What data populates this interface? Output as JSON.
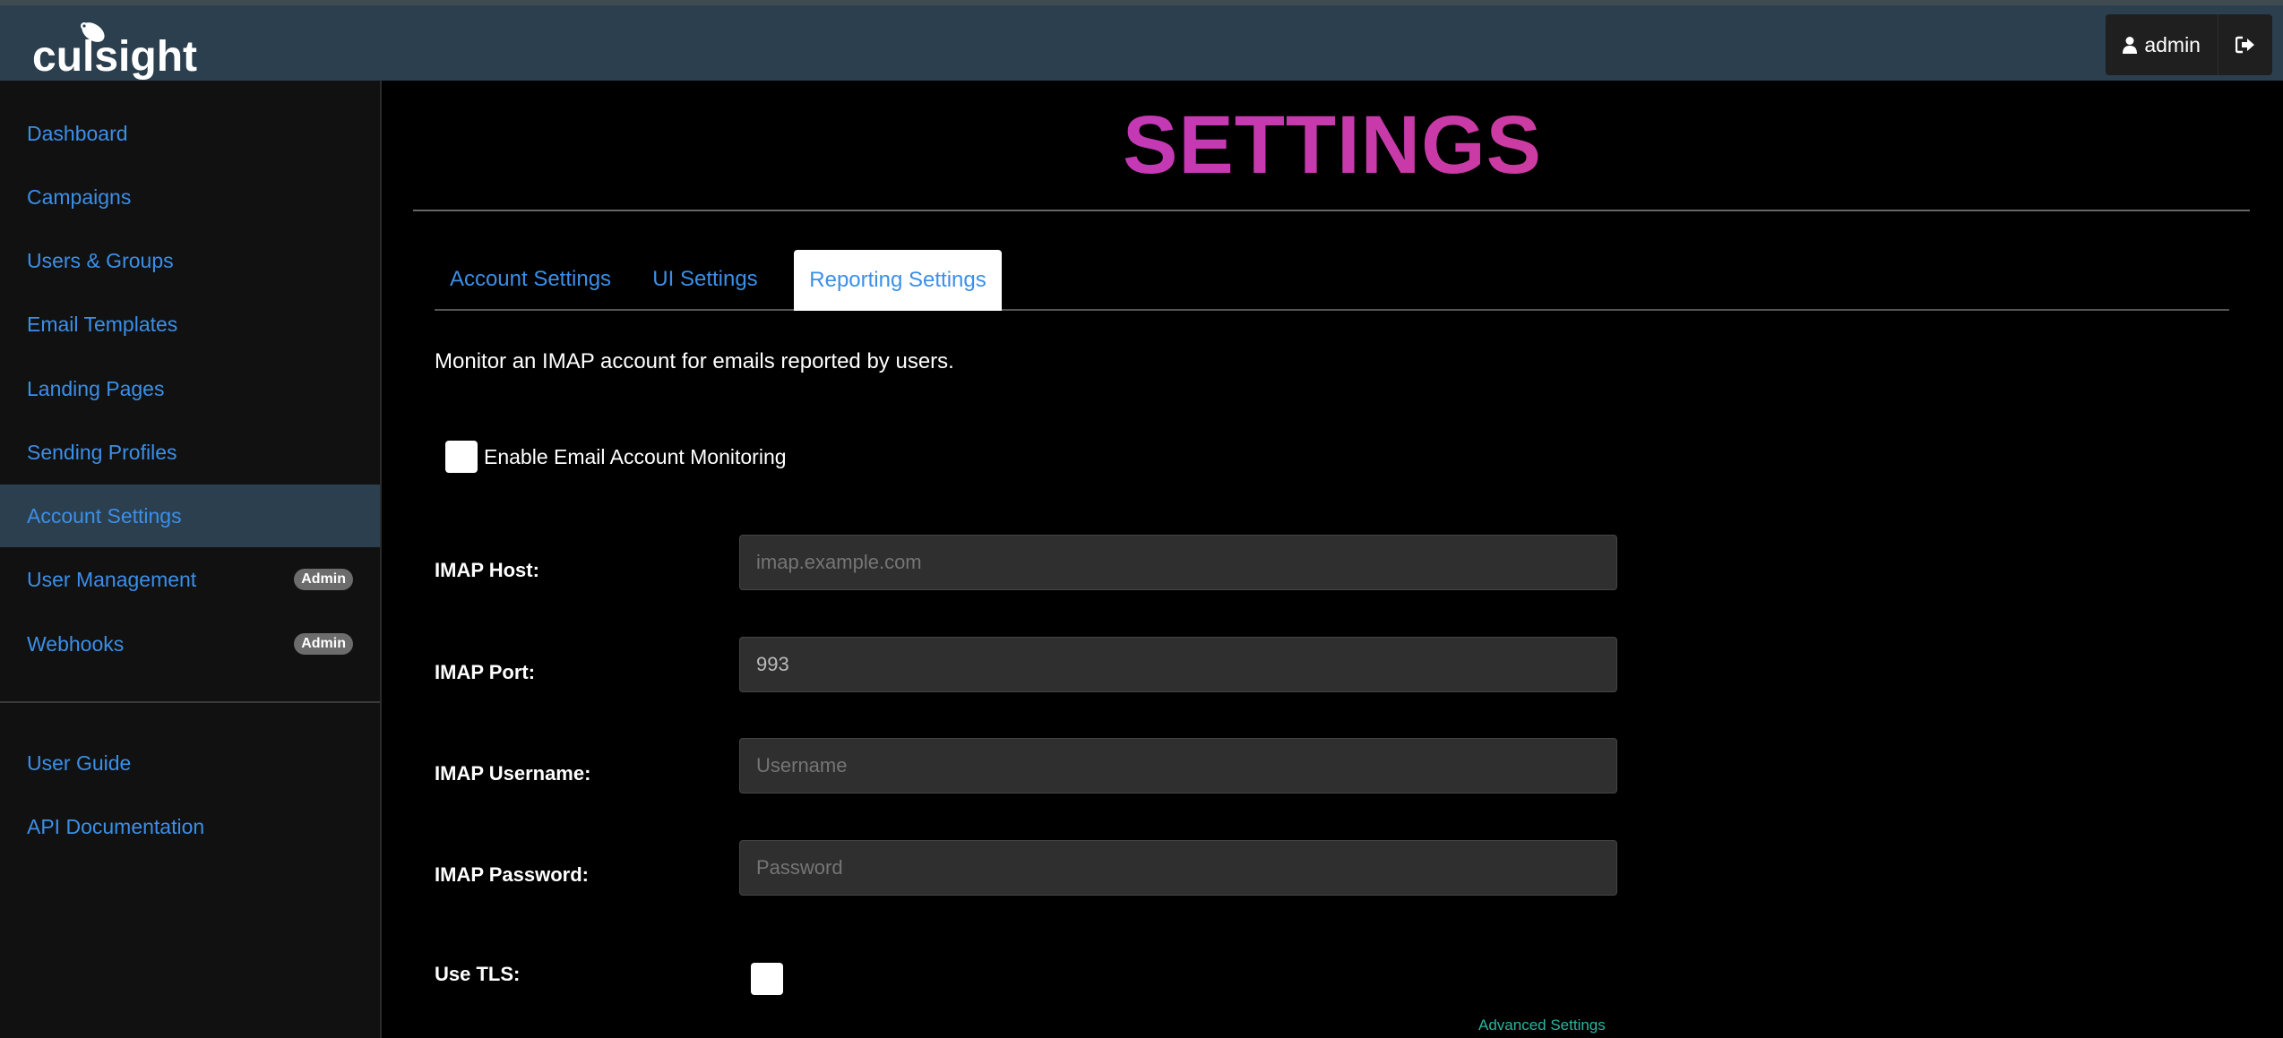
{
  "header": {
    "logo_text": "culsight",
    "user_label": "admin"
  },
  "sidebar": {
    "items": [
      {
        "label": "Dashboard"
      },
      {
        "label": "Campaigns"
      },
      {
        "label": "Users & Groups"
      },
      {
        "label": "Email Templates"
      },
      {
        "label": "Landing Pages"
      },
      {
        "label": "Sending Profiles"
      },
      {
        "label": "Account Settings"
      },
      {
        "label": "User Management",
        "badge": "Admin"
      },
      {
        "label": "Webhooks",
        "badge": "Admin"
      }
    ],
    "footer_items": [
      {
        "label": "User Guide"
      },
      {
        "label": "API Documentation"
      }
    ]
  },
  "main": {
    "title": "SETTINGS",
    "tabs": [
      {
        "label": "Account Settings"
      },
      {
        "label": "UI Settings"
      },
      {
        "label": "Reporting Settings"
      }
    ],
    "description": "Monitor an IMAP account for emails reported by users.",
    "enable_label": "Enable Email Account Monitoring",
    "fields": [
      {
        "label": "IMAP Host:",
        "placeholder": "imap.example.com"
      },
      {
        "label": "IMAP Port:",
        "value": "993"
      },
      {
        "label": "IMAP Username:",
        "placeholder": "Username"
      },
      {
        "label": "IMAP Password:",
        "placeholder": "Password"
      }
    ],
    "tls_label": "Use TLS:",
    "advanced_link": "Advanced Settings"
  },
  "colors": {
    "accent": "#3b8fe8",
    "navbar": "#2b3f4e",
    "link_green": "#2bb5a0"
  }
}
